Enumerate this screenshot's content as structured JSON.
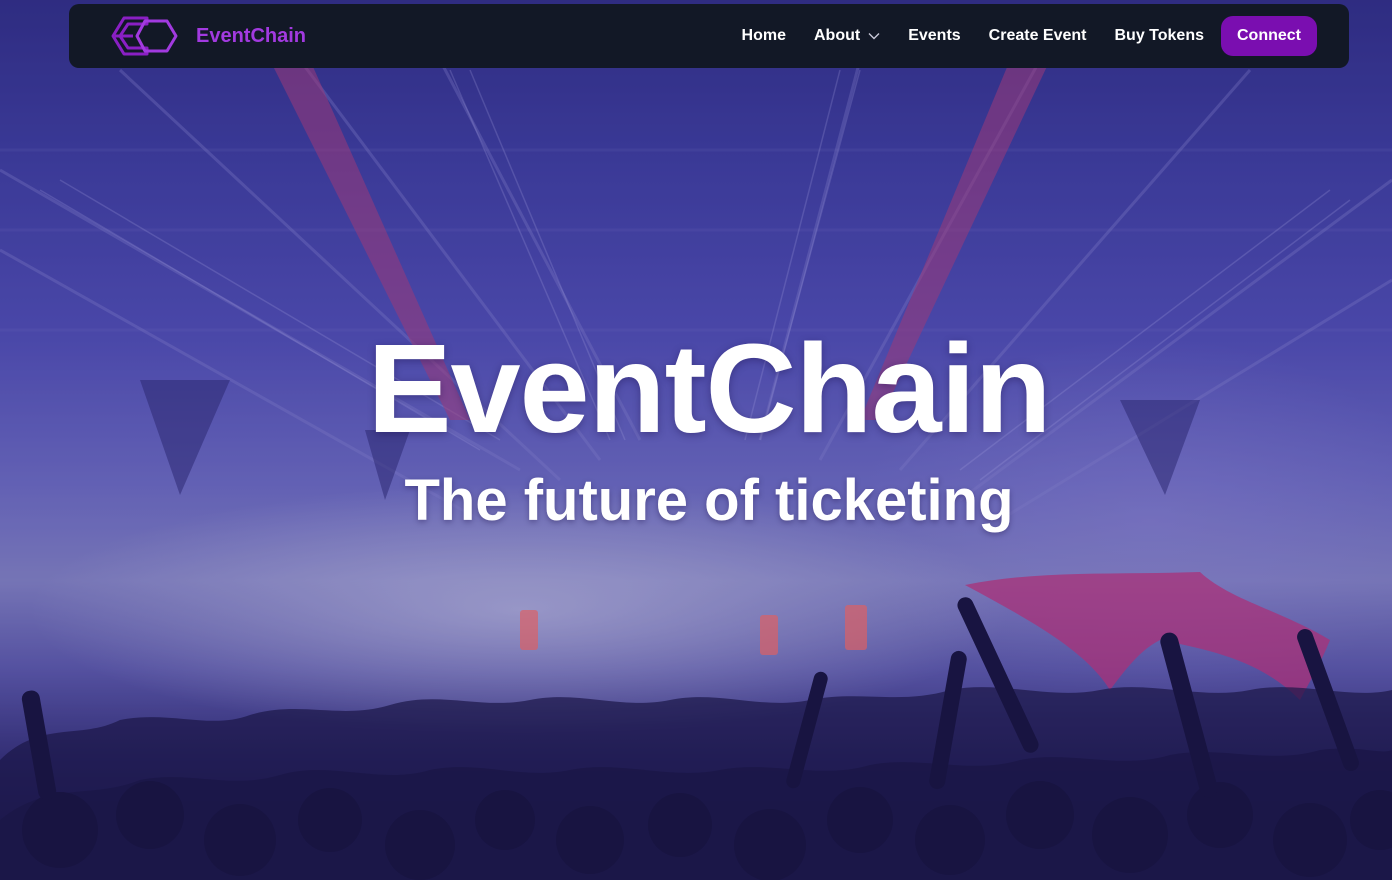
{
  "navbar": {
    "brand_name": "EventChain",
    "logo_icon": "eventchain-hexagon-logo",
    "links": [
      {
        "label": "Home"
      },
      {
        "label": "About",
        "has_dropdown": true
      },
      {
        "label": "Events"
      },
      {
        "label": "Create Event"
      },
      {
        "label": "Buy Tokens"
      }
    ],
    "connect_label": "Connect"
  },
  "hero": {
    "title": "EventChain",
    "subtitle": "The future of ticketing",
    "background": "concert-crowd-photo"
  },
  "colors": {
    "brand_purple": "#a23ae0",
    "button_purple": "#7a0eb0",
    "navbar_bg": "#121826",
    "hero_tint": "#3c37aa"
  }
}
